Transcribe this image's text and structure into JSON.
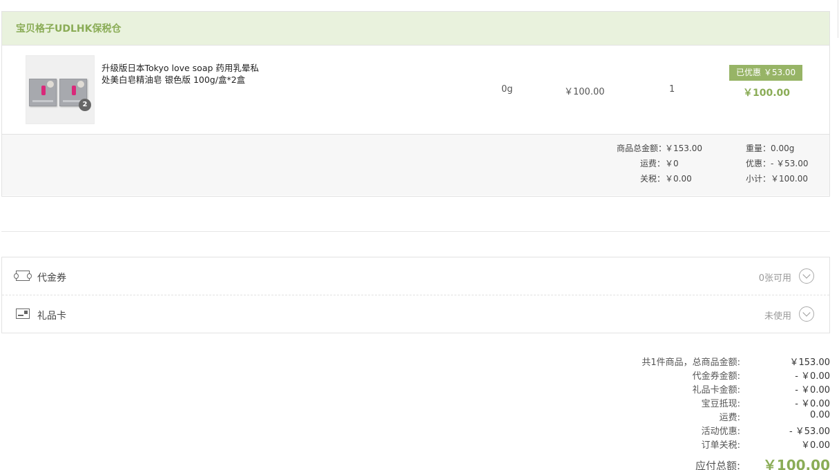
{
  "warehouse": {
    "name": "宝贝格子UDLHK保税仓",
    "product": {
      "title": "升级版日本Tokyo love soap 药用乳晕私处美白皂精油皂 银色版 100g/盒*2盒",
      "image_badge": "2",
      "weight": "0g",
      "price": "￥100.00",
      "quantity": "1",
      "discount_badge": "已优惠 ￥53.00",
      "subtotal": "￥100.00"
    },
    "summary": {
      "goods_total_label": "商品总金额：",
      "goods_total_value": "￥153.00",
      "shipping_label": "运费：",
      "shipping_value": "￥0",
      "tax_label": "关税：",
      "tax_value": "￥0.00",
      "weight_label": "重量：",
      "weight_value": "0.00g",
      "discount_label": "优惠：",
      "discount_value": "- ￥53.00",
      "subtotal_label": "小计：",
      "subtotal_value": "￥100.00"
    }
  },
  "options": {
    "coupon": {
      "label": "代金券",
      "status": "0张可用",
      "icon": "coupon-icon"
    },
    "gift_card": {
      "label": "礼品卡",
      "status": "未使用",
      "icon": "gift-card-icon"
    }
  },
  "totals": {
    "rows": [
      {
        "label": "共1件商品，总商品金额:",
        "value": "￥153.00"
      },
      {
        "label": "代金券金额:",
        "value": "- ￥0.00"
      },
      {
        "label": "礼品卡金额:",
        "value": "- ￥0.00"
      },
      {
        "label": "宝豆抵现:",
        "value": "- ￥0.00"
      },
      {
        "label": "运费:",
        "value": "0.00"
      },
      {
        "label": "活动优惠:",
        "value": "- ￥53.00"
      },
      {
        "label": "订单关税:",
        "value": "￥0.00"
      }
    ],
    "grand_label": "应付总额:",
    "grand_value": "￥100.00"
  },
  "colors": {
    "accent_green": "#8aac56",
    "header_bg": "#e9f2dd",
    "badge_bg": "#97b466"
  }
}
